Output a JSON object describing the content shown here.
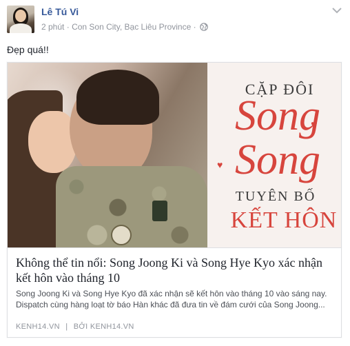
{
  "post": {
    "author": "Lê Tú Vi",
    "time": "2 phút",
    "separator": "·",
    "location": "Con Son City, Bạc Liêu Province",
    "privacy_icon": "globe-icon",
    "menu_icon": "chevron-down-icon",
    "status": "Đẹp quá!!"
  },
  "link_card": {
    "image_text": {
      "line1": "CẶP ĐÔI",
      "line2": "Song",
      "line3": "Song",
      "line4": "TUYÊN BỐ",
      "line5": "KẾT HÔN"
    },
    "title": "Không thể tin nổi: Song Joong Ki và Song Hye Kyo xác nhận kết hôn vào tháng 10",
    "description": "Song Joong Ki và Song Hye Kyo đã xác nhận sẽ kết hôn vào tháng 10 vào sáng nay. Dispatch cùng hàng loạt tờ báo Hàn khác đã đưa tin về đám cưới của Song Joong...",
    "domain": "KENH14.VN",
    "divider": "|",
    "by_label": "BỞI",
    "by_source": "KENH14.VN"
  },
  "colors": {
    "author_link": "#365899",
    "meta_gray": "#90949c",
    "accent_red": "#d7453d",
    "border": "#dddfe2"
  }
}
